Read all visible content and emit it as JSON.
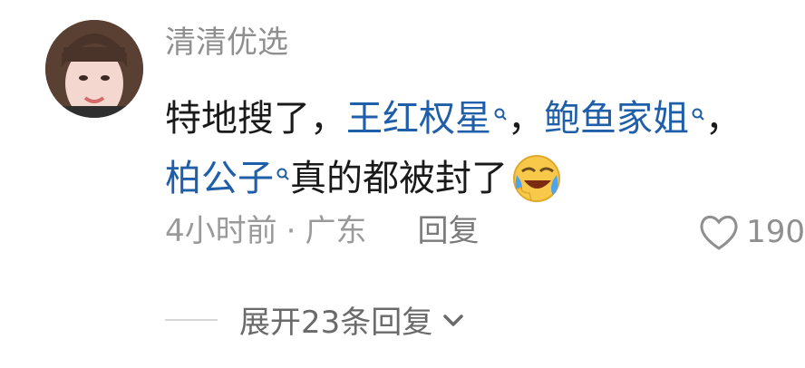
{
  "comment": {
    "username": "清清优选",
    "line1_prefix": "特地搜了，",
    "link1": "王红权星",
    "sep1": "，",
    "link2": "鲍鱼家姐",
    "sep2": "，",
    "link3": "柏公子",
    "line2_suffix": "真的都被封了",
    "emoji": "laughing-crying-emoji",
    "time": "4小时前",
    "dot": "·",
    "location": "广东",
    "reply_label": "回复",
    "like_count": "190"
  },
  "expand": {
    "label": "展开23条回复"
  },
  "colors": {
    "link": "#1f5ea8",
    "muted": "#9a9a9a",
    "text": "#1a1a1a"
  }
}
